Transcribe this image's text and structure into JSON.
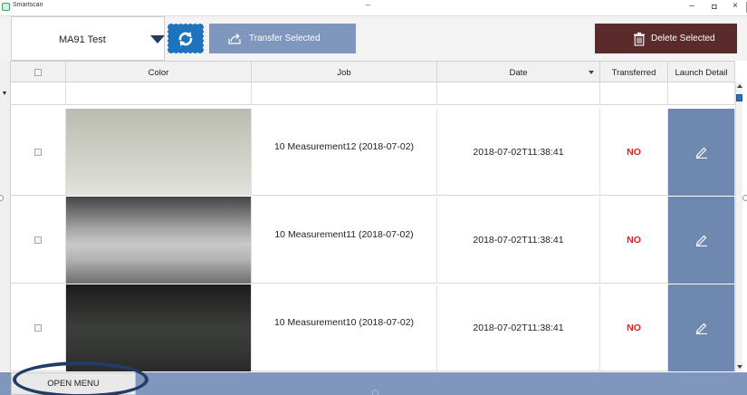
{
  "window": {
    "title": "Smartscan",
    "center_mark": "–",
    "controls": {
      "minimize": "–",
      "maximize": "◘",
      "close": "×"
    }
  },
  "toolbar": {
    "device_name": "MA91 Test",
    "transfer_label": "Transfer Selected",
    "delete_label": "Delete Selected"
  },
  "table": {
    "columns": {
      "select": "",
      "color": "Color",
      "job": "Job",
      "date": "Date",
      "transferred": "Transferred",
      "launch_detail": "Launch Detail"
    },
    "rows": [
      {
        "job": "10 Measurement12 (2018-07-02)",
        "date": "2018-07-02T11:38:41",
        "transferred": "NO"
      },
      {
        "job": "10 Measurement11 (2018-07-02)",
        "date": "2018-07-02T11:38:41",
        "transferred": "NO"
      },
      {
        "job": "10 Measurement10 (2018-07-02)",
        "date": "2018-07-02T11:38:41",
        "transferred": "NO"
      }
    ]
  },
  "bottom": {
    "open_menu_label": "OPEN MENU"
  },
  "colors": {
    "accent": "#7f97bd",
    "refresh": "#1e73be",
    "delete": "#5b2b2b",
    "not_transferred": "#e02020",
    "detail_cell": "#6f88b0"
  },
  "icons": {
    "refresh": "refresh-icon",
    "transfer": "transfer-icon",
    "delete": "trash-icon",
    "edit": "pencil-icon"
  }
}
